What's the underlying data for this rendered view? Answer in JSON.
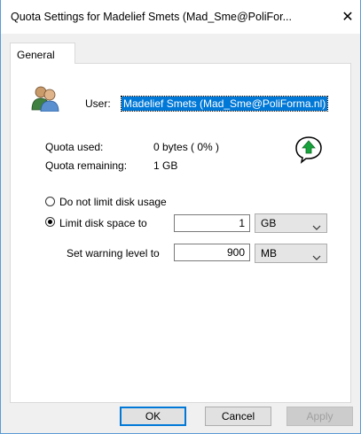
{
  "window": {
    "title": "Quota Settings for Madelief Smets (Mad_Sme@PoliFor...",
    "close_glyph": "✕"
  },
  "tabs": [
    {
      "label": "General"
    }
  ],
  "user": {
    "label": "User:",
    "value": "Madelief Smets (Mad_Sme@PoliForma.nl)",
    "icon": "users-icon"
  },
  "quota": {
    "used_label": "Quota used:",
    "used_value": "0 bytes ( 0% )",
    "remaining_label": "Quota remaining:",
    "remaining_value": "1 GB",
    "status_icon": "green-up-arrow-icon"
  },
  "limit": {
    "no_limit_label": "Do not limit disk usage",
    "limit_label": "Limit disk space to",
    "limit_value": "1",
    "limit_unit": "GB",
    "warning_label": "Set warning level to",
    "warning_value": "900",
    "warning_unit": "MB",
    "selected": "limit"
  },
  "buttons": {
    "ok": "OK",
    "cancel": "Cancel",
    "apply": "Apply"
  },
  "colors": {
    "accent": "#0078d7",
    "border": "#5a9bd5"
  }
}
